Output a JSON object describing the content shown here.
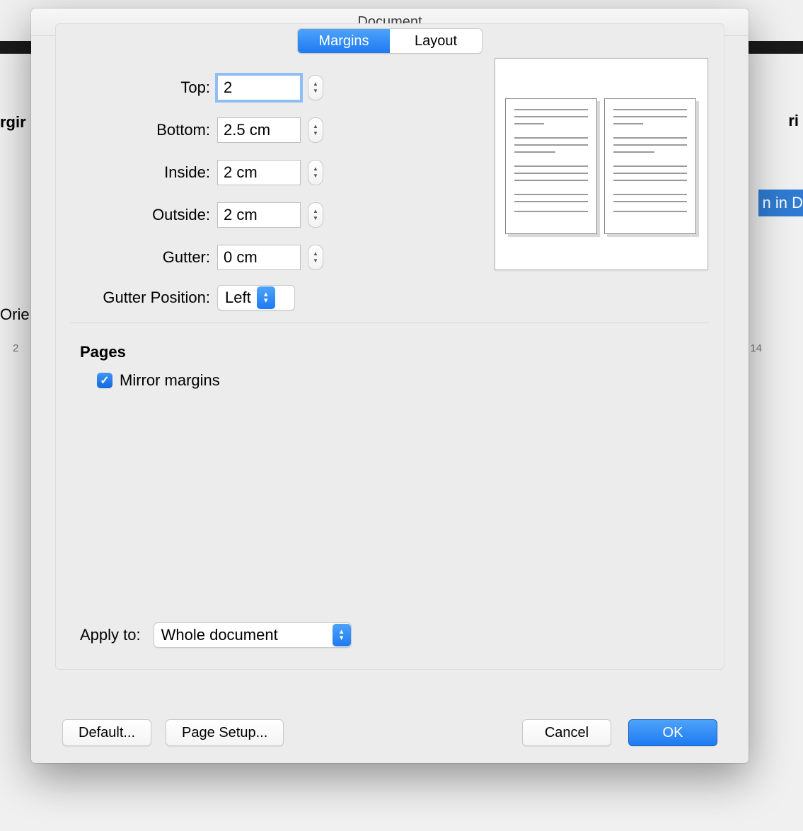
{
  "dialog": {
    "title": "Document",
    "tabs": {
      "margins": "Margins",
      "layout": "Layout"
    },
    "margins": {
      "top": {
        "label": "Top:",
        "value": "2"
      },
      "bottom": {
        "label": "Bottom:",
        "value": "2.5 cm"
      },
      "inside": {
        "label": "Inside:",
        "value": "2 cm"
      },
      "outside": {
        "label": "Outside:",
        "value": "2 cm"
      },
      "gutter": {
        "label": "Gutter:",
        "value": "0 cm"
      },
      "gutter_position": {
        "label": "Gutter Position:",
        "value": "Left"
      }
    },
    "pages": {
      "heading": "Pages",
      "mirror_label": "Mirror margins",
      "mirror_checked": true
    },
    "apply_to": {
      "label": "Apply to:",
      "value": "Whole document"
    },
    "buttons": {
      "default": "Default...",
      "page_setup": "Page Setup...",
      "cancel": "Cancel",
      "ok": "OK"
    }
  },
  "background": {
    "orie": "Orie",
    "rgir": "rgir",
    "ri": "ri",
    "in_d": "n in D",
    "ruler_left": "2",
    "ruler_right": "14"
  }
}
